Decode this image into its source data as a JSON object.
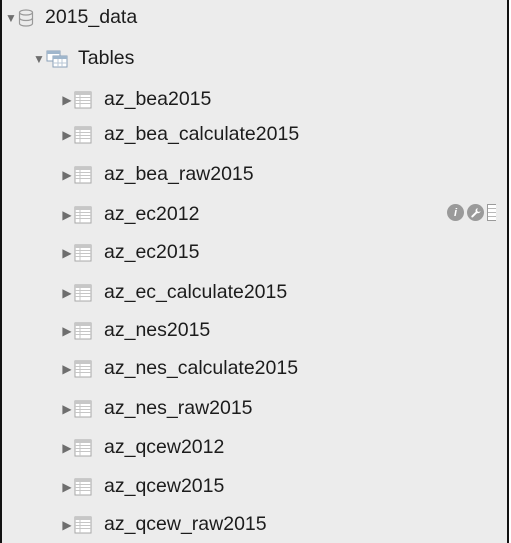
{
  "database": {
    "name": "2015_data",
    "expanded": true,
    "icon": "database-icon"
  },
  "tables_group": {
    "label": "Tables",
    "expanded": true,
    "icon": "tables-folder-icon"
  },
  "tables": [
    {
      "name": "az_bea2015",
      "icon": "table-icon"
    },
    {
      "name": "az_bea_calculate2015",
      "icon": "table-icon"
    },
    {
      "name": "az_bea_raw2015",
      "icon": "table-icon"
    },
    {
      "name": "az_ec2012",
      "icon": "table-icon"
    },
    {
      "name": "az_ec2015",
      "icon": "table-icon"
    },
    {
      "name": "az_ec_calculate2015",
      "icon": "table-icon"
    },
    {
      "name": "az_nes2015",
      "icon": "table-icon"
    },
    {
      "name": "az_nes_calculate2015",
      "icon": "table-icon"
    },
    {
      "name": "az_nes_raw2015",
      "icon": "table-icon"
    },
    {
      "name": "az_qcew2012",
      "icon": "table-icon"
    },
    {
      "name": "az_qcew2015",
      "icon": "table-icon"
    },
    {
      "name": "az_qcew_raw2015",
      "icon": "table-icon"
    }
  ],
  "row_actions": {
    "info_icon": "info-icon",
    "wrench_icon": "wrench-icon",
    "info_glyph": "i"
  },
  "colors": {
    "sidebar_background": "#ececec",
    "icon_gray": "#9a9a9a",
    "text": "#1c1c1c"
  }
}
